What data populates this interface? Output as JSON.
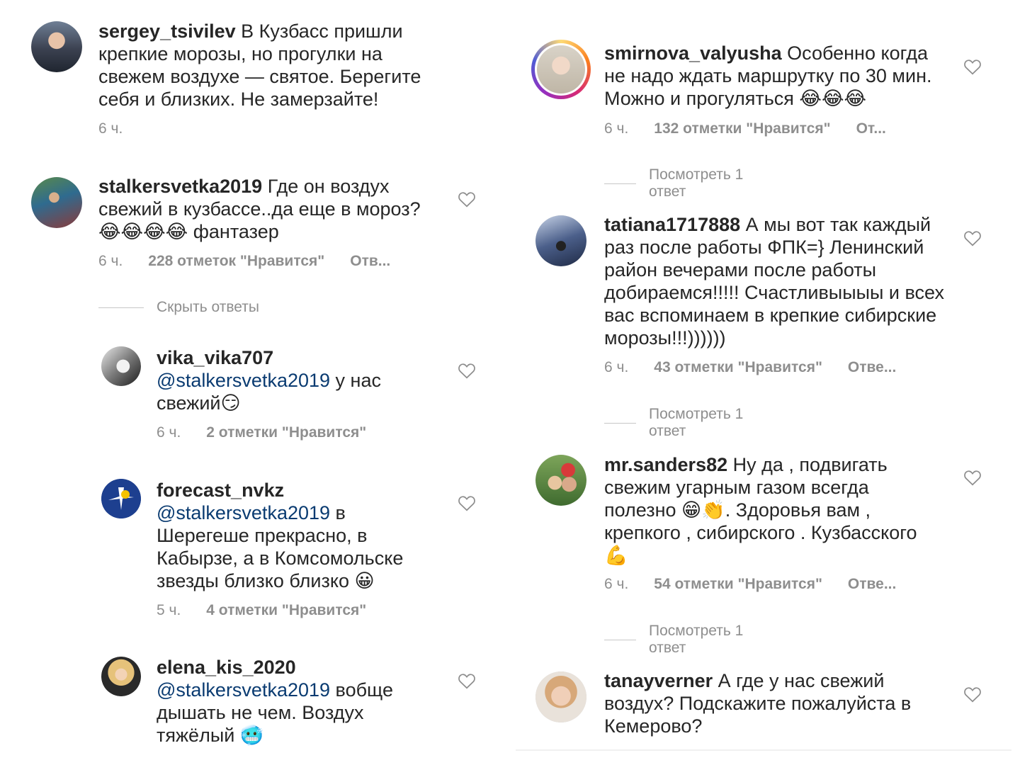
{
  "left": {
    "comments": [
      {
        "username": "sergey_tsivilev",
        "text": " В Кузбасс пришли крепкие морозы, но прогулки на свежем воздухе — святое. Берегите себя и близких. Не замерзайте!",
        "time": "6 ч.",
        "likes": "",
        "reply": ""
      },
      {
        "username": "stalkersvetka2019",
        "text": " Где он воздух свежий в кузбассе..да еще в мороз? 😂😂😂😂 фантазер",
        "time": "6 ч.",
        "likes": "228 отметок \"Нравится\"",
        "reply": "Отв..."
      }
    ],
    "hide_replies": "Скрыть ответы",
    "replies": [
      {
        "username": "vika_vika707",
        "mention": "@stalkersvetka2019",
        "text": " у нас свежий😏",
        "time": "6 ч.",
        "likes": "2 отметки \"Нравится\""
      },
      {
        "username": "forecast_nvkz",
        "mention": "@stalkersvetka2019",
        "text": " в Шерегеше прекрасно, в Кабырзе, а в Комсомольске звезды близко близко 😀",
        "time": "5 ч.",
        "likes": "4 отметки \"Нравится\""
      },
      {
        "username": "elena_kis_2020",
        "mention": "@stalkersvetka2019",
        "text": " вобще дышать не чем. Воздух тяжёлый 🥶",
        "time": "",
        "likes": ""
      }
    ]
  },
  "right": {
    "comments": [
      {
        "username": "smirnova_valyusha",
        "text": " Особенно когда не надо ждать маршрутку по 30 мин. Можно и прогуляться 😂😂😂",
        "time": "6 ч.",
        "likes": "132 отметки \"Нравится\"",
        "reply": "От...",
        "view_replies": "Посмотреть 1 ответ"
      },
      {
        "username": "tatiana1717888",
        "text": " А мы вот так каждый раз после работы ФПК=} Ленинский район вечерами после работы добираемся!!!!! Счастливыыыы и всех вас вспоминаем в крепкие сибирские морозы!!!))))))",
        "time": "6 ч.",
        "likes": "43 отметки \"Нравится\"",
        "reply": "Отве...",
        "view_replies": "Посмотреть 1 ответ"
      },
      {
        "username": "mr.sanders82",
        "text": " Ну да , подвигать свежим угарным газом всегда полезно 😁👏. Здоровья вам , крепкого , сибирского . Кузбасского 💪",
        "time": "6 ч.",
        "likes": "54 отметки \"Нравится\"",
        "reply": "Отве...",
        "view_replies": "Посмотреть 1 ответ"
      },
      {
        "username": "tanayverner",
        "text": " А где у нас свежий воздух? Подскажите пожалуйста в Кемерово?",
        "time": "",
        "likes": "",
        "reply": ""
      }
    ]
  },
  "colors": {
    "text": "#262626",
    "meta": "#8e8e8e",
    "mention": "#0a3b71",
    "divider": "#c7c7c7"
  },
  "icons": {
    "like": "heart-outline-icon"
  }
}
